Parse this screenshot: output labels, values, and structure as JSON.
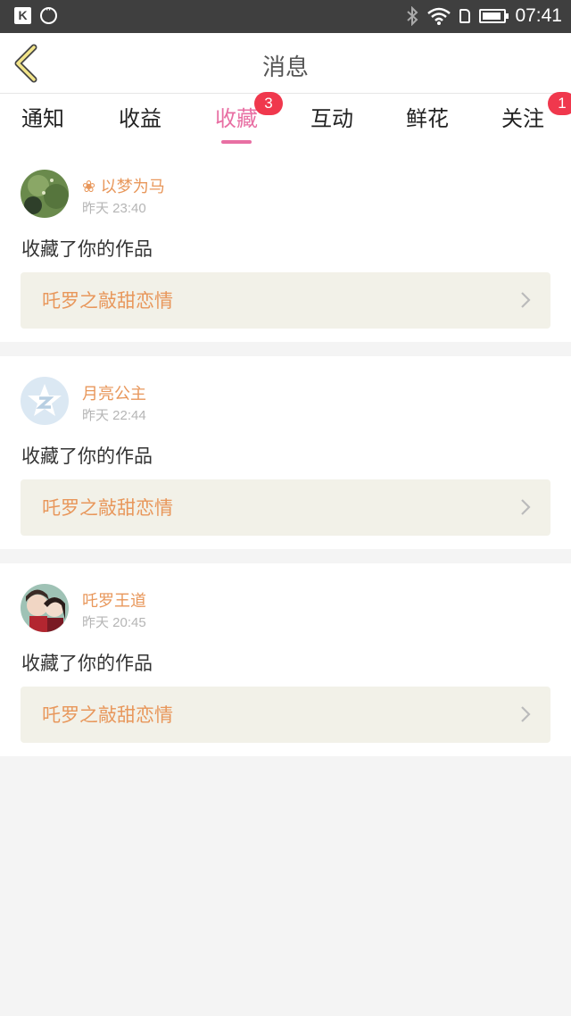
{
  "status_bar": {
    "time": "07:41",
    "icons": [
      "k-app-icon",
      "chat-icon",
      "bluetooth-icon",
      "wifi-icon",
      "sim-icon",
      "battery-icon"
    ]
  },
  "header": {
    "title": "消息",
    "back_icon": "chevron-left-icon"
  },
  "tabs": [
    {
      "label": "通知",
      "badge": ""
    },
    {
      "label": "收益",
      "badge": ""
    },
    {
      "label": "收藏",
      "badge": "3",
      "active": true
    },
    {
      "label": "互动",
      "badge": ""
    },
    {
      "label": "鲜花",
      "badge": ""
    },
    {
      "label": "关注",
      "badge": "1"
    }
  ],
  "items": [
    {
      "name": "❀ 以梦为马",
      "time": "昨天 23:40",
      "action": "收藏了你的作品",
      "work": "吒罗之敲甜恋情"
    },
    {
      "name": "月亮公主",
      "time": "昨天 22:44",
      "action": "收藏了你的作品",
      "work": "吒罗之敲甜恋情"
    },
    {
      "name": "吒罗王道",
      "time": "昨天 20:45",
      "action": "收藏了你的作品",
      "work": "吒罗之敲甜恋情"
    }
  ],
  "colors": {
    "accent": "#e86fa3",
    "name": "#e8975b",
    "badge": "#f0384d",
    "link_bg": "#f2f1e8"
  }
}
